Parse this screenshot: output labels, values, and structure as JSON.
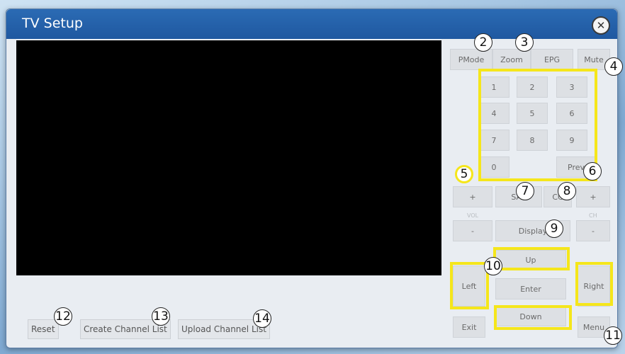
{
  "window": {
    "title": "TV Setup"
  },
  "bottom_bar": {
    "reset": "Reset",
    "create_channel_list": "Create Channel List",
    "upload_channel_list": "Upload Channel List"
  },
  "remote": {
    "pmode": "PMode",
    "zoom": "Zoom",
    "epg": "EPG",
    "mute": "Mute",
    "digits": [
      "1",
      "2",
      "3",
      "4",
      "5",
      "6",
      "7",
      "8",
      "9",
      "0"
    ],
    "prev": "Prev",
    "vol_plus": "+",
    "sap": "SAP",
    "cc": "CC",
    "ch_plus": "+",
    "vol_label": "VOL",
    "ch_label": "CH",
    "vol_minus": "-",
    "display": "Display",
    "ch_minus": "-",
    "up": "Up",
    "left": "Left",
    "enter": "Enter",
    "right": "Right",
    "down": "Down",
    "exit": "Exit",
    "menu": "Menu"
  },
  "callouts": [
    "2",
    "3",
    "4",
    "5",
    "6",
    "7",
    "8",
    "9",
    "10",
    "11",
    "12",
    "13",
    "14"
  ],
  "colors": {
    "titlebar": "#2266b0",
    "highlight": "#f5e61b"
  }
}
